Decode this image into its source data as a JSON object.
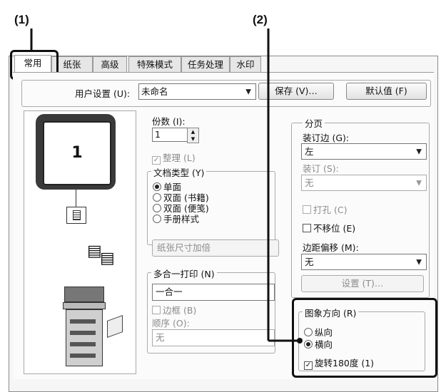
{
  "callouts": {
    "one": "(1)",
    "two": "(2)"
  },
  "tabs": [
    "常用",
    "纸张",
    "高级",
    "特殊模式",
    "任务处理",
    "水印"
  ],
  "toolbar": {
    "user_settings_label": "用户设置 (U):",
    "user_settings_value": "未命名",
    "save_label": "保存 (V)…",
    "default_label": "默认值 (F)"
  },
  "copies": {
    "label": "份数 (I):",
    "value": "1"
  },
  "collate": {
    "label": "整理 (L)",
    "checked": true
  },
  "preview": {
    "page_number": "1"
  },
  "doc_type": {
    "title": "文档类型 (Y)",
    "options": [
      "单面",
      "双面 (书籍)",
      "双面 (便笺)",
      "手册样式"
    ],
    "selected": 0,
    "paper_size_button": "纸张尺寸加倍"
  },
  "nup": {
    "title": "多合一打印 (N)",
    "value": "一合一",
    "border_label": "边框 (B)",
    "order_label": "顺序 (O):",
    "order_value": "无"
  },
  "finishing": {
    "title": "分页",
    "binding_edge_label": "装订边 (G):",
    "binding_edge_value": "左",
    "staple_label": "装订 (S):",
    "staple_value": "无",
    "punch_label": "打孔 (C)",
    "no_offset_label": "不移位 (E)",
    "margin_shift_label": "边距偏移 (M):",
    "margin_shift_value": "无",
    "settings_button": "设置 (T)…"
  },
  "orientation": {
    "title": "图象方向 (R)",
    "options": [
      "纵向",
      "横向"
    ],
    "selected": 1,
    "rotate_label": "旋转180度 (1)",
    "rotate_checked": true
  }
}
